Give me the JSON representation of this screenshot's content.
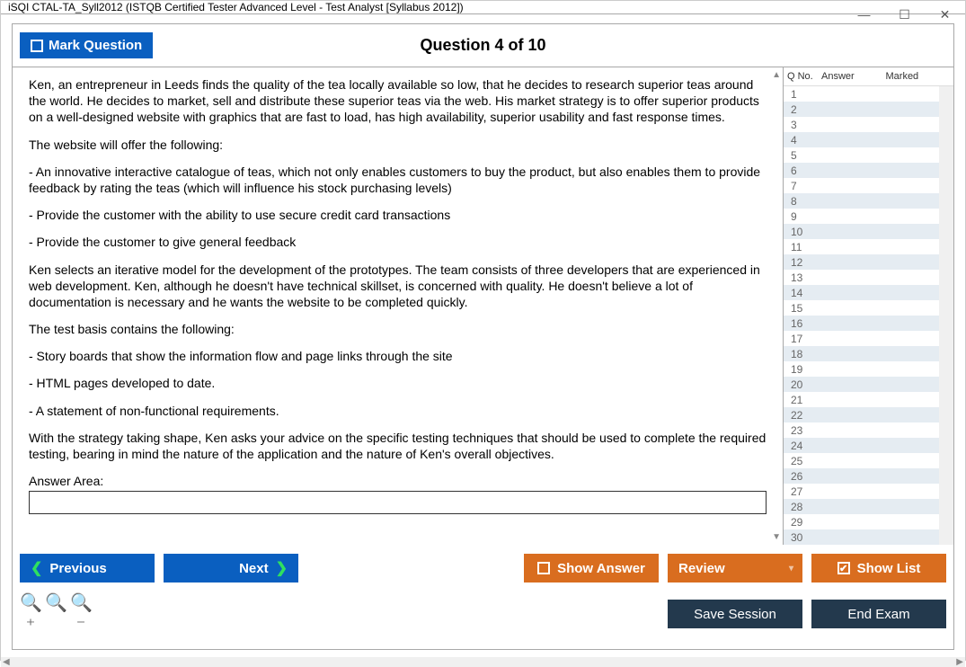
{
  "window": {
    "title": "iSQI CTAL-TA_Syll2012 (ISTQB Certified Tester Advanced Level - Test Analyst [Syllabus 2012])"
  },
  "header": {
    "mark_label": "Mark Question",
    "question_title": "Question 4 of 10"
  },
  "question": {
    "p1": "Ken, an entrepreneur in Leeds finds the quality of the tea locally available so low, that he decides to research superior teas around the world. He decides to market, sell and distribute these superior teas via the web. His market strategy is to offer superior products on a well-designed website with graphics that are fast to load, has high availability, superior usability and fast response times.",
    "p2": "The website will offer the following:",
    "p3": "- An innovative interactive catalogue of teas, which not only enables customers to buy the product, but also enables them to provide feedback by rating the teas (which will influence his stock purchasing levels)",
    "p4": "- Provide the customer with the ability to use secure credit card transactions",
    "p5": "- Provide the customer to give general feedback",
    "p6": "Ken selects an iterative model for the development of the prototypes. The team consists of three developers that are experienced in web development. Ken, although he doesn't have technical skillset, is concerned with quality. He doesn't believe a lot of documentation is necessary and he wants the website to be completed quickly.",
    "p7": "The test basis contains the following:",
    "p8": "- Story boards that show the information flow and page links through the site",
    "p9": "- HTML pages developed to date.",
    "p10": "- A statement of non-functional requirements.",
    "p11": "With the strategy taking shape, Ken asks your advice on the specific testing techniques that should be used to complete the required testing, bearing in mind the nature of the application and the nature of Ken's overall objectives.",
    "answer_area_label": "Answer Area:",
    "answer_value": ""
  },
  "sidebar": {
    "col_qno": "Q No.",
    "col_answer": "Answer",
    "col_marked": "Marked",
    "rows": [
      "1",
      "2",
      "3",
      "4",
      "5",
      "6",
      "7",
      "8",
      "9",
      "10",
      "11",
      "12",
      "13",
      "14",
      "15",
      "16",
      "17",
      "18",
      "19",
      "20",
      "21",
      "22",
      "23",
      "24",
      "25",
      "26",
      "27",
      "28",
      "29",
      "30"
    ]
  },
  "buttons": {
    "previous": "Previous",
    "next": "Next",
    "show_answer": "Show Answer",
    "review": "Review",
    "show_list": "Show List",
    "save_session": "Save Session",
    "end_exam": "End Exam"
  }
}
